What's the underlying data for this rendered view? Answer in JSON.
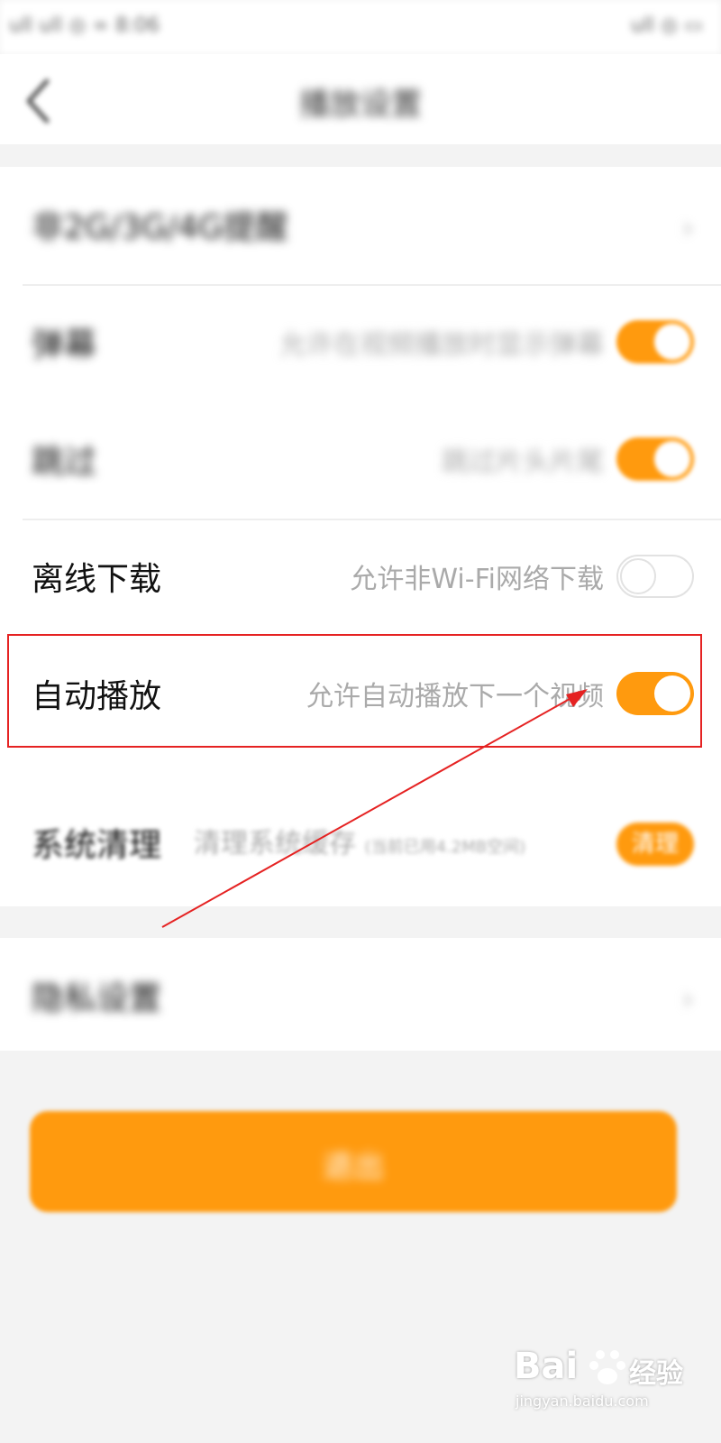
{
  "status_bar": {
    "left_text": "ull ull ◎ ∞ 8:06",
    "right_text": "ull ◎ ▭"
  },
  "nav": {
    "back_icon": "chevron-left-icon",
    "title": "播放设置"
  },
  "settings": {
    "item1": {
      "label": "非2G/3G/4G提醒",
      "chevron": "›"
    },
    "item2": {
      "label": "弹幕",
      "desc": "允许在视频播放时显示弹幕",
      "toggle": "on"
    },
    "item3": {
      "label": "跳过",
      "desc": "跳过片头片尾",
      "toggle": "on"
    },
    "offline": {
      "label": "离线下载",
      "desc": "允许非Wi-Fi网络下载",
      "toggle": "off"
    },
    "autoplay": {
      "label": "自动播放",
      "desc": "允许自动播放下一个视频",
      "toggle": "on"
    },
    "clean": {
      "label": "系统清理",
      "desc": "清理系统缓存",
      "desc_small": "(当前已用4.2MB空间)",
      "button": "清理"
    },
    "item_bottom": {
      "label": "隐私设置",
      "chevron": "›"
    }
  },
  "main_button": {
    "label": "退出"
  },
  "annotations": {
    "highlight_color": "#e52222",
    "arrow_color": "#e52222"
  },
  "colors": {
    "accent": "#ff9a0e",
    "background": "#f3f3f3"
  },
  "watermark": {
    "brand": "Bai",
    "cn": "经验",
    "url": "jingyan.baidu.com"
  }
}
